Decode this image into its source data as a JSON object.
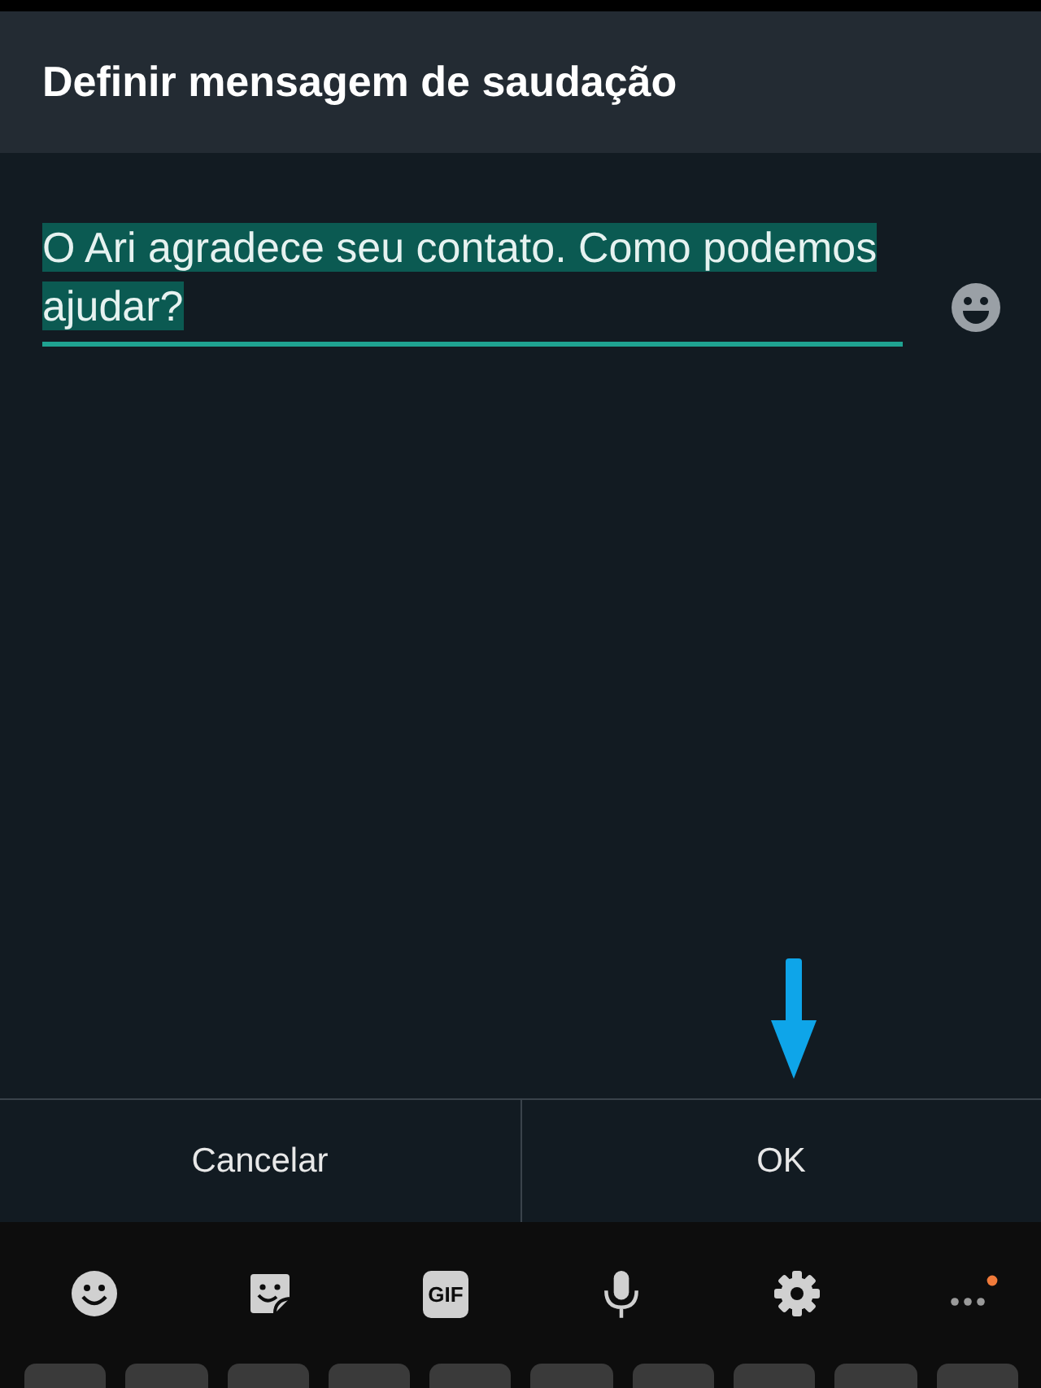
{
  "dialog": {
    "title": "Definir mensagem de saudação",
    "field": {
      "value": "O Ari agradece seu contato. Como podemos ajudar?",
      "selected": true
    },
    "buttons": [
      {
        "label": "Cancelar"
      },
      {
        "label": "OK",
        "pointed": true
      }
    ]
  },
  "keyboard": {
    "toolbar": [
      {
        "kind": "emoji"
      },
      {
        "kind": "sticker"
      },
      {
        "kind": "gif",
        "label": "GIF"
      },
      {
        "kind": "mic"
      },
      {
        "kind": "settings"
      },
      {
        "kind": "more"
      }
    ]
  }
}
